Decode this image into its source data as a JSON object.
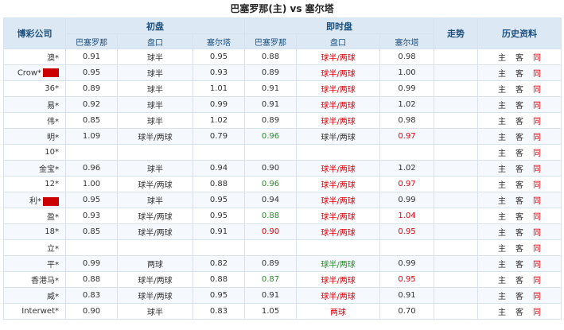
{
  "title": "巴塞罗那(主) vs 塞尔塔",
  "headers": {
    "company": "博彩公司",
    "initial": "初盘",
    "live": "即时盘",
    "trend": "走势",
    "history": "历史资料",
    "home": "巴塞罗那",
    "handicap": "盘口",
    "away": "塞尔塔"
  },
  "history_labels": {
    "zhu": "主",
    "ke": "客",
    "tong": "同"
  },
  "rows": [
    {
      "company": "澳*",
      "i_home": "0.91",
      "i_hc": "球半",
      "i_away": "0.95",
      "l_home": "0.88",
      "l_hc": "球半/两球",
      "l_away": "0.98"
    },
    {
      "company": "Crow*",
      "i_home": "0.95",
      "i_hc": "球半",
      "i_away": "0.93",
      "l_home": "0.89",
      "l_hc": "球半/两球",
      "l_away": "1.00"
    },
    {
      "company": "36*",
      "i_home": "0.89",
      "i_hc": "球半",
      "i_away": "1.01",
      "l_home": "0.91",
      "l_hc": "球半/两球",
      "l_away": "0.99"
    },
    {
      "company": "易*",
      "i_home": "0.92",
      "i_hc": "球半",
      "i_away": "0.99",
      "l_home": "0.91",
      "l_hc": "球半/两球",
      "l_away": "1.02"
    },
    {
      "company": "伟*",
      "i_home": "0.85",
      "i_hc": "球半",
      "i_away": "1.02",
      "l_home": "0.89",
      "l_hc": "球半/两球",
      "l_away": "0.98"
    },
    {
      "company": "明*",
      "i_home": "1.09",
      "i_hc": "球半/两球",
      "i_away": "0.79",
      "l_home": "0.96",
      "l_hc": "球半/两球",
      "l_away": "0.97"
    },
    {
      "company": "10*",
      "i_home": "",
      "i_hc": "",
      "i_away": "",
      "l_home": "",
      "l_hc": "",
      "l_away": ""
    },
    {
      "company": "金宝*",
      "i_home": "0.96",
      "i_hc": "球半",
      "i_away": "0.94",
      "l_home": "0.90",
      "l_hc": "球半/两球",
      "l_away": "1.02"
    },
    {
      "company": "12*",
      "i_home": "1.00",
      "i_hc": "球半/两球",
      "i_away": "0.88",
      "l_home": "0.96",
      "l_hc": "球半/两球",
      "l_away": "0.97"
    },
    {
      "company": "利*",
      "i_home": "0.95",
      "i_hc": "球半",
      "i_away": "0.95",
      "l_home": "0.94",
      "l_hc": "球半/两球",
      "l_away": "0.99"
    },
    {
      "company": "盈*",
      "i_home": "0.93",
      "i_hc": "球半/两球",
      "i_away": "0.95",
      "l_home": "0.88",
      "l_hc": "球半/两球",
      "l_away": "1.04"
    },
    {
      "company": "18*",
      "i_home": "0.85",
      "i_hc": "球半/两球",
      "i_away": "0.91",
      "l_home": "0.90",
      "l_hc": "球半/两球",
      "l_away": "0.95"
    },
    {
      "company": "立*",
      "i_home": "",
      "i_hc": "",
      "i_away": "",
      "l_home": "",
      "l_hc": "",
      "l_away": ""
    },
    {
      "company": "平*",
      "i_home": "0.99",
      "i_hc": "两球",
      "i_away": "0.82",
      "l_home": "0.89",
      "l_hc": "球半/两球",
      "l_away": "0.99"
    },
    {
      "company": "香港马*",
      "i_home": "0.88",
      "i_hc": "球半/两球",
      "i_away": "0.88",
      "l_home": "0.87",
      "l_hc": "球半/两球",
      "l_away": "0.95"
    },
    {
      "company": "威*",
      "i_home": "0.83",
      "i_hc": "球半/两球",
      "i_away": "0.95",
      "l_home": "0.91",
      "l_hc": "球半/两球",
      "l_away": "0.91"
    },
    {
      "company": "Interwet*",
      "i_home": "0.90",
      "i_hc": "球半",
      "i_away": "0.83",
      "l_home": "1.05",
      "l_hc": "两球",
      "l_away": "0.70"
    }
  ],
  "style_hints": {
    "header_bg": "#dce9f5",
    "header_text": "#1b4f7d",
    "up_color": "#2a8a2a",
    "down_color": "#e0000a"
  }
}
